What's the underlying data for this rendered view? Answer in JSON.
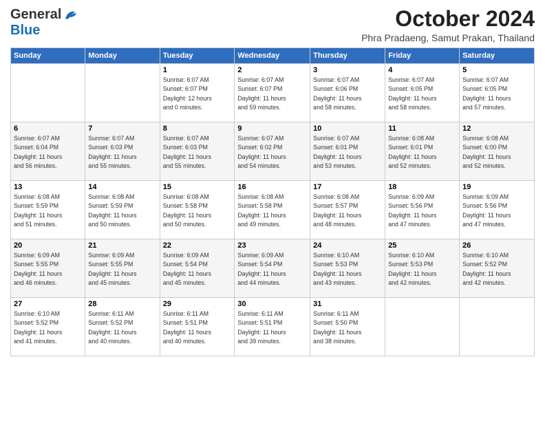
{
  "header": {
    "logo_general": "General",
    "logo_blue": "Blue",
    "month_title": "October 2024",
    "location": "Phra Pradaeng, Samut Prakan, Thailand"
  },
  "days_of_week": [
    "Sunday",
    "Monday",
    "Tuesday",
    "Wednesday",
    "Thursday",
    "Friday",
    "Saturday"
  ],
  "weeks": [
    [
      {
        "day": "",
        "info": ""
      },
      {
        "day": "",
        "info": ""
      },
      {
        "day": "1",
        "info": "Sunrise: 6:07 AM\nSunset: 6:07 PM\nDaylight: 12 hours\nand 0 minutes."
      },
      {
        "day": "2",
        "info": "Sunrise: 6:07 AM\nSunset: 6:07 PM\nDaylight: 11 hours\nand 59 minutes."
      },
      {
        "day": "3",
        "info": "Sunrise: 6:07 AM\nSunset: 6:06 PM\nDaylight: 11 hours\nand 58 minutes."
      },
      {
        "day": "4",
        "info": "Sunrise: 6:07 AM\nSunset: 6:05 PM\nDaylight: 11 hours\nand 58 minutes."
      },
      {
        "day": "5",
        "info": "Sunrise: 6:07 AM\nSunset: 6:05 PM\nDaylight: 11 hours\nand 57 minutes."
      }
    ],
    [
      {
        "day": "6",
        "info": "Sunrise: 6:07 AM\nSunset: 6:04 PM\nDaylight: 11 hours\nand 56 minutes."
      },
      {
        "day": "7",
        "info": "Sunrise: 6:07 AM\nSunset: 6:03 PM\nDaylight: 11 hours\nand 55 minutes."
      },
      {
        "day": "8",
        "info": "Sunrise: 6:07 AM\nSunset: 6:03 PM\nDaylight: 11 hours\nand 55 minutes."
      },
      {
        "day": "9",
        "info": "Sunrise: 6:07 AM\nSunset: 6:02 PM\nDaylight: 11 hours\nand 54 minutes."
      },
      {
        "day": "10",
        "info": "Sunrise: 6:07 AM\nSunset: 6:01 PM\nDaylight: 11 hours\nand 53 minutes."
      },
      {
        "day": "11",
        "info": "Sunrise: 6:08 AM\nSunset: 6:01 PM\nDaylight: 11 hours\nand 52 minutes."
      },
      {
        "day": "12",
        "info": "Sunrise: 6:08 AM\nSunset: 6:00 PM\nDaylight: 11 hours\nand 52 minutes."
      }
    ],
    [
      {
        "day": "13",
        "info": "Sunrise: 6:08 AM\nSunset: 5:59 PM\nDaylight: 11 hours\nand 51 minutes."
      },
      {
        "day": "14",
        "info": "Sunrise: 6:08 AM\nSunset: 5:59 PM\nDaylight: 11 hours\nand 50 minutes."
      },
      {
        "day": "15",
        "info": "Sunrise: 6:08 AM\nSunset: 5:58 PM\nDaylight: 11 hours\nand 50 minutes."
      },
      {
        "day": "16",
        "info": "Sunrise: 6:08 AM\nSunset: 5:58 PM\nDaylight: 11 hours\nand 49 minutes."
      },
      {
        "day": "17",
        "info": "Sunrise: 6:08 AM\nSunset: 5:57 PM\nDaylight: 11 hours\nand 48 minutes."
      },
      {
        "day": "18",
        "info": "Sunrise: 6:09 AM\nSunset: 5:56 PM\nDaylight: 11 hours\nand 47 minutes."
      },
      {
        "day": "19",
        "info": "Sunrise: 6:09 AM\nSunset: 5:56 PM\nDaylight: 11 hours\nand 47 minutes."
      }
    ],
    [
      {
        "day": "20",
        "info": "Sunrise: 6:09 AM\nSunset: 5:55 PM\nDaylight: 11 hours\nand 46 minutes."
      },
      {
        "day": "21",
        "info": "Sunrise: 6:09 AM\nSunset: 5:55 PM\nDaylight: 11 hours\nand 45 minutes."
      },
      {
        "day": "22",
        "info": "Sunrise: 6:09 AM\nSunset: 5:54 PM\nDaylight: 11 hours\nand 45 minutes."
      },
      {
        "day": "23",
        "info": "Sunrise: 6:09 AM\nSunset: 5:54 PM\nDaylight: 11 hours\nand 44 minutes."
      },
      {
        "day": "24",
        "info": "Sunrise: 6:10 AM\nSunset: 5:53 PM\nDaylight: 11 hours\nand 43 minutes."
      },
      {
        "day": "25",
        "info": "Sunrise: 6:10 AM\nSunset: 5:53 PM\nDaylight: 11 hours\nand 42 minutes."
      },
      {
        "day": "26",
        "info": "Sunrise: 6:10 AM\nSunset: 5:52 PM\nDaylight: 11 hours\nand 42 minutes."
      }
    ],
    [
      {
        "day": "27",
        "info": "Sunrise: 6:10 AM\nSunset: 5:52 PM\nDaylight: 11 hours\nand 41 minutes."
      },
      {
        "day": "28",
        "info": "Sunrise: 6:11 AM\nSunset: 5:52 PM\nDaylight: 11 hours\nand 40 minutes."
      },
      {
        "day": "29",
        "info": "Sunrise: 6:11 AM\nSunset: 5:51 PM\nDaylight: 11 hours\nand 40 minutes."
      },
      {
        "day": "30",
        "info": "Sunrise: 6:11 AM\nSunset: 5:51 PM\nDaylight: 11 hours\nand 39 minutes."
      },
      {
        "day": "31",
        "info": "Sunrise: 6:11 AM\nSunset: 5:50 PM\nDaylight: 11 hours\nand 38 minutes."
      },
      {
        "day": "",
        "info": ""
      },
      {
        "day": "",
        "info": ""
      }
    ]
  ]
}
